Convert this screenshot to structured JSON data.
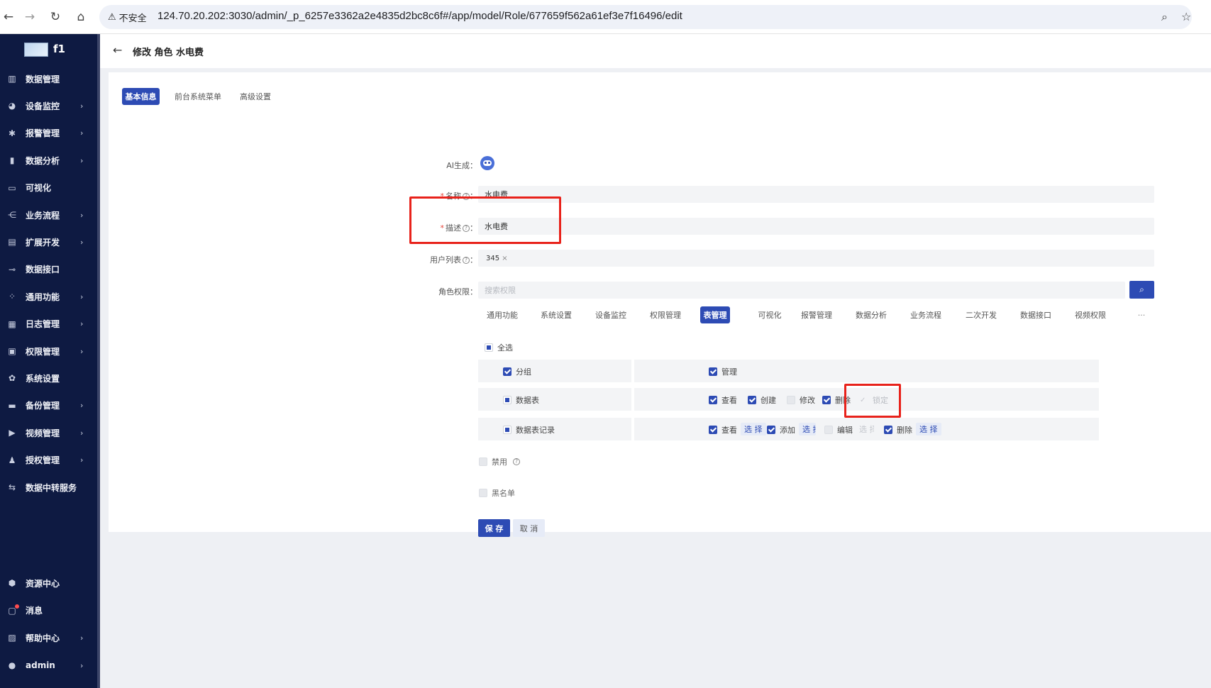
{
  "browser": {
    "security_label": "不安全",
    "url": "124.70.20.202:3030/admin/_p_6257e3362a2e4835d2bc8c6f#/app/model/Role/677659f562a61ef3e7f16496/edit"
  },
  "sidebar": {
    "app_name": "f1",
    "items": [
      {
        "label": "数据管理",
        "icon": "chart-icon",
        "arrow": false
      },
      {
        "label": "设备监控",
        "icon": "palette-icon",
        "arrow": true
      },
      {
        "label": "报警管理",
        "icon": "bug-icon",
        "arrow": true
      },
      {
        "label": "数据分析",
        "icon": "bar-chart-icon",
        "arrow": true
      },
      {
        "label": "可视化",
        "icon": "screen-icon",
        "arrow": false
      },
      {
        "label": "业务流程",
        "icon": "flow-icon",
        "arrow": true
      },
      {
        "label": "扩展开发",
        "icon": "code-icon",
        "arrow": true
      },
      {
        "label": "数据接口",
        "icon": "api-icon",
        "arrow": false
      },
      {
        "label": "通用功能",
        "icon": "apps-icon",
        "arrow": true
      },
      {
        "label": "日志管理",
        "icon": "log-icon",
        "arrow": true
      },
      {
        "label": "权限管理",
        "icon": "lock-icon",
        "arrow": true
      },
      {
        "label": "系统设置",
        "icon": "gear-icon",
        "arrow": false
      },
      {
        "label": "备份管理",
        "icon": "backup-icon",
        "arrow": true
      },
      {
        "label": "视频管理",
        "icon": "video-icon",
        "arrow": true
      },
      {
        "label": "授权管理",
        "icon": "user-key-icon",
        "arrow": true
      },
      {
        "label": "数据中转服务",
        "icon": "transfer-icon",
        "arrow": false
      }
    ],
    "bottom_items": [
      {
        "label": "资源中心",
        "icon": "cube-icon",
        "arrow": false
      },
      {
        "label": "消息",
        "icon": "message-icon",
        "arrow": false
      },
      {
        "label": "帮助中心",
        "icon": "help-icon",
        "arrow": true
      },
      {
        "label": "admin",
        "icon": "user-icon",
        "arrow": true
      }
    ]
  },
  "header": {
    "title": "修改 角色 水电费"
  },
  "tabs": [
    "基本信息",
    "前台系统菜单",
    "高级设置"
  ],
  "form": {
    "ai_label": "AI生成：",
    "name_label": "名称",
    "name_value": "水电费",
    "desc_label": "描述",
    "desc_value": "水电费",
    "users_label": "用户列表",
    "users_tag": "345",
    "perm_label": "角色权限：",
    "perm_placeholder": "搜索权限"
  },
  "perm_tabs": [
    "通用功能",
    "系统设置",
    "设备监控",
    "权限管理",
    "表管理",
    "可视化",
    "报警管理",
    "数据分析",
    "业务流程",
    "二次开发",
    "数据接口",
    "视频权限"
  ],
  "perm_more": "···",
  "select_all": "全选",
  "perm_rows": {
    "group": {
      "name": "分组",
      "manage": "管理"
    },
    "table": {
      "name": "数据表",
      "view": "查看",
      "create": "创建",
      "modify": "修改",
      "delete": "删除",
      "lock": "锁定"
    },
    "record": {
      "name": "数据表记录",
      "view": "查看",
      "add": "添加",
      "edit": "编辑",
      "delete": "删除",
      "select": "选 择"
    }
  },
  "disabled_label": "禁用",
  "blacklist_label": "黑名单",
  "save_label": "保 存",
  "cancel_label": "取 消",
  "colors": {
    "primary": "#2d4bb4",
    "sidebar": "#0e1a42",
    "highlight": "#e8221b"
  }
}
